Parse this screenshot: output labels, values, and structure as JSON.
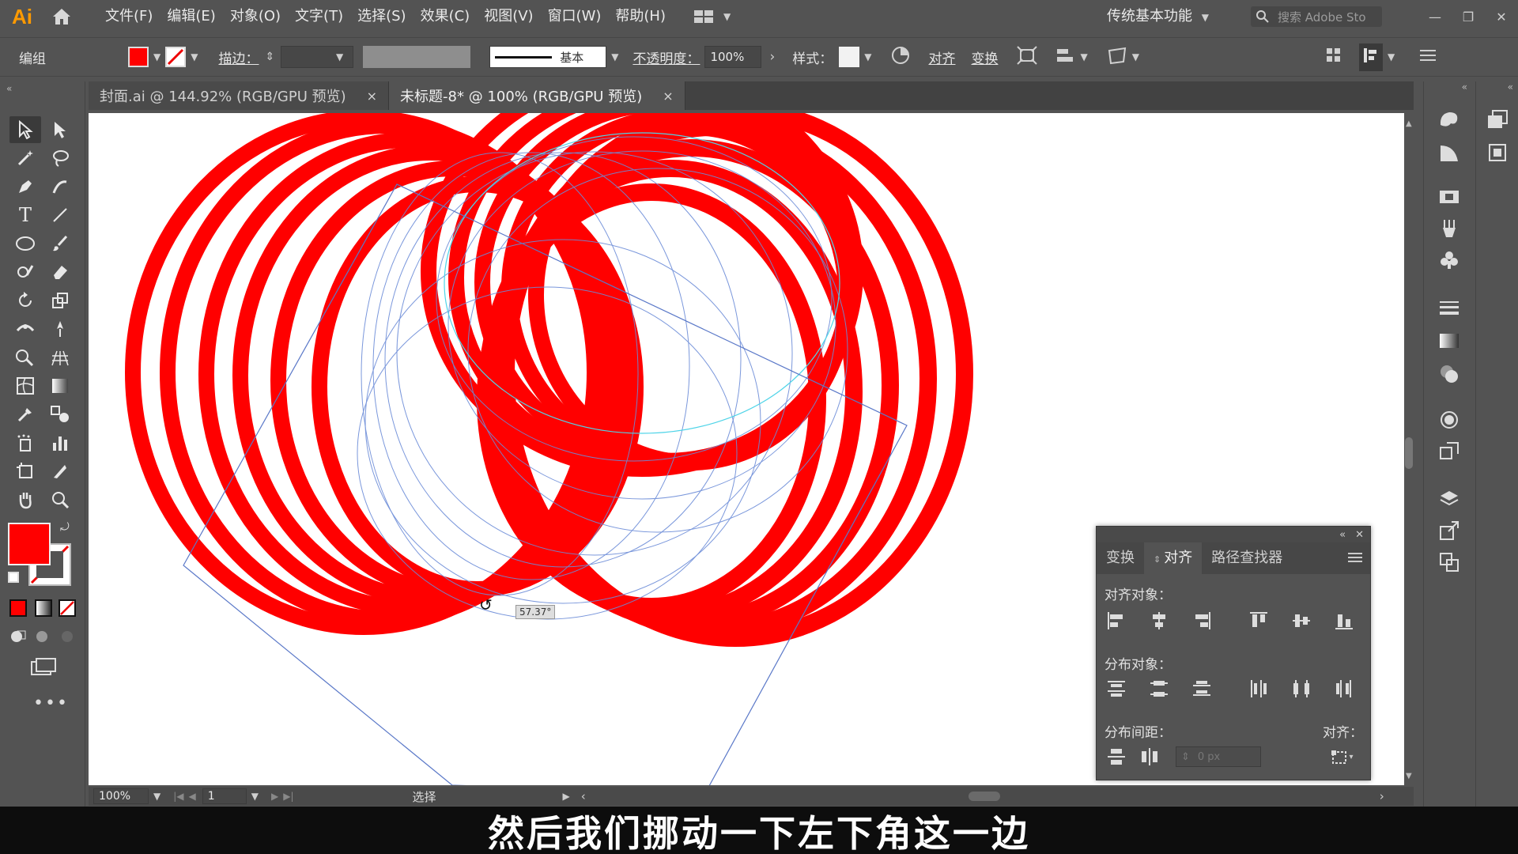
{
  "app": {
    "logo": "Ai"
  },
  "menu": [
    "文件(F)",
    "编辑(E)",
    "对象(O)",
    "文字(T)",
    "选择(S)",
    "效果(C)",
    "视图(V)",
    "窗口(W)",
    "帮助(H)"
  ],
  "workspace": "传统基本功能",
  "search": {
    "placeholder": "搜索 Adobe Sto"
  },
  "controlbar": {
    "selection_label": "编组",
    "stroke_label": "描边：",
    "profile_label": "基本",
    "opacity_label": "不透明度：",
    "opacity_value": "100%",
    "style_label": "样式：",
    "align_label": "对齐",
    "transform_label": "变换"
  },
  "tabs": [
    {
      "label": "封面.ai @ 144.92% (RGB/GPU 预览)",
      "close": "×"
    },
    {
      "label": "未标题-8* @ 100% (RGB/GPU 预览)",
      "close": "×"
    }
  ],
  "canvas": {
    "rotate_readout": "57.37°",
    "fill_color": "#ff0000"
  },
  "status": {
    "zoom": "100%",
    "page": "1",
    "tool": "选择"
  },
  "align_panel": {
    "tabs": [
      "变换",
      "对齐",
      "路径查找器"
    ],
    "align_objects_label": "对齐对象：",
    "distribute_objects_label": "分布对象：",
    "distribute_spacing_label": "分布间距：",
    "align_to_label": "对齐：",
    "spacing_value": "0 px"
  },
  "subtitle": "然后我们挪动一下左下角这一边"
}
